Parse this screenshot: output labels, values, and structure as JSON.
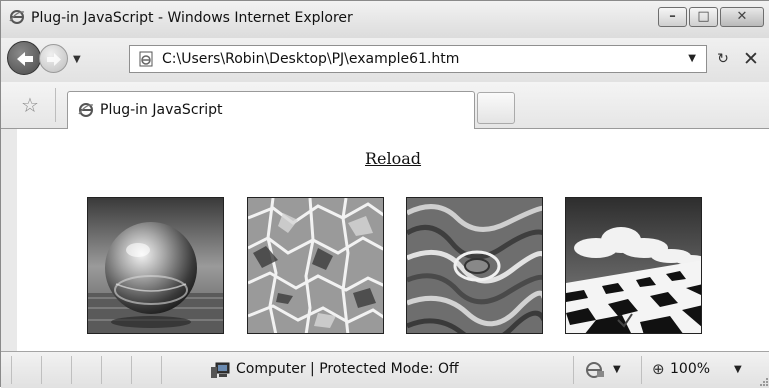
{
  "window": {
    "title": "Plug-in JavaScript - Windows Internet Explorer",
    "buttons": {
      "minimize": "–",
      "maximize": "□",
      "close": "✕"
    }
  },
  "navbar": {
    "address": "C:\\Users\\Robin\\Desktop\\PJ\\example61.htm",
    "dropdown_glyph": "▼",
    "refresh_glyph": "↻",
    "stop_glyph": "✕"
  },
  "tabs": [
    {
      "label": "Plug-in JavaScript"
    }
  ],
  "content": {
    "reload_link": "Reload",
    "images": [
      {
        "name": "chrome-sphere"
      },
      {
        "name": "stained-glass-pattern"
      },
      {
        "name": "marble-swirl"
      },
      {
        "name": "checkerboard-clouds"
      }
    ]
  },
  "statusbar": {
    "zone": "Computer | Protected Mode: Off",
    "zoom": "100%",
    "dropdown_glyph": "▼"
  },
  "colors": {
    "chrome_bg": "#e9e9e9",
    "content_bg": "#ffffff"
  }
}
